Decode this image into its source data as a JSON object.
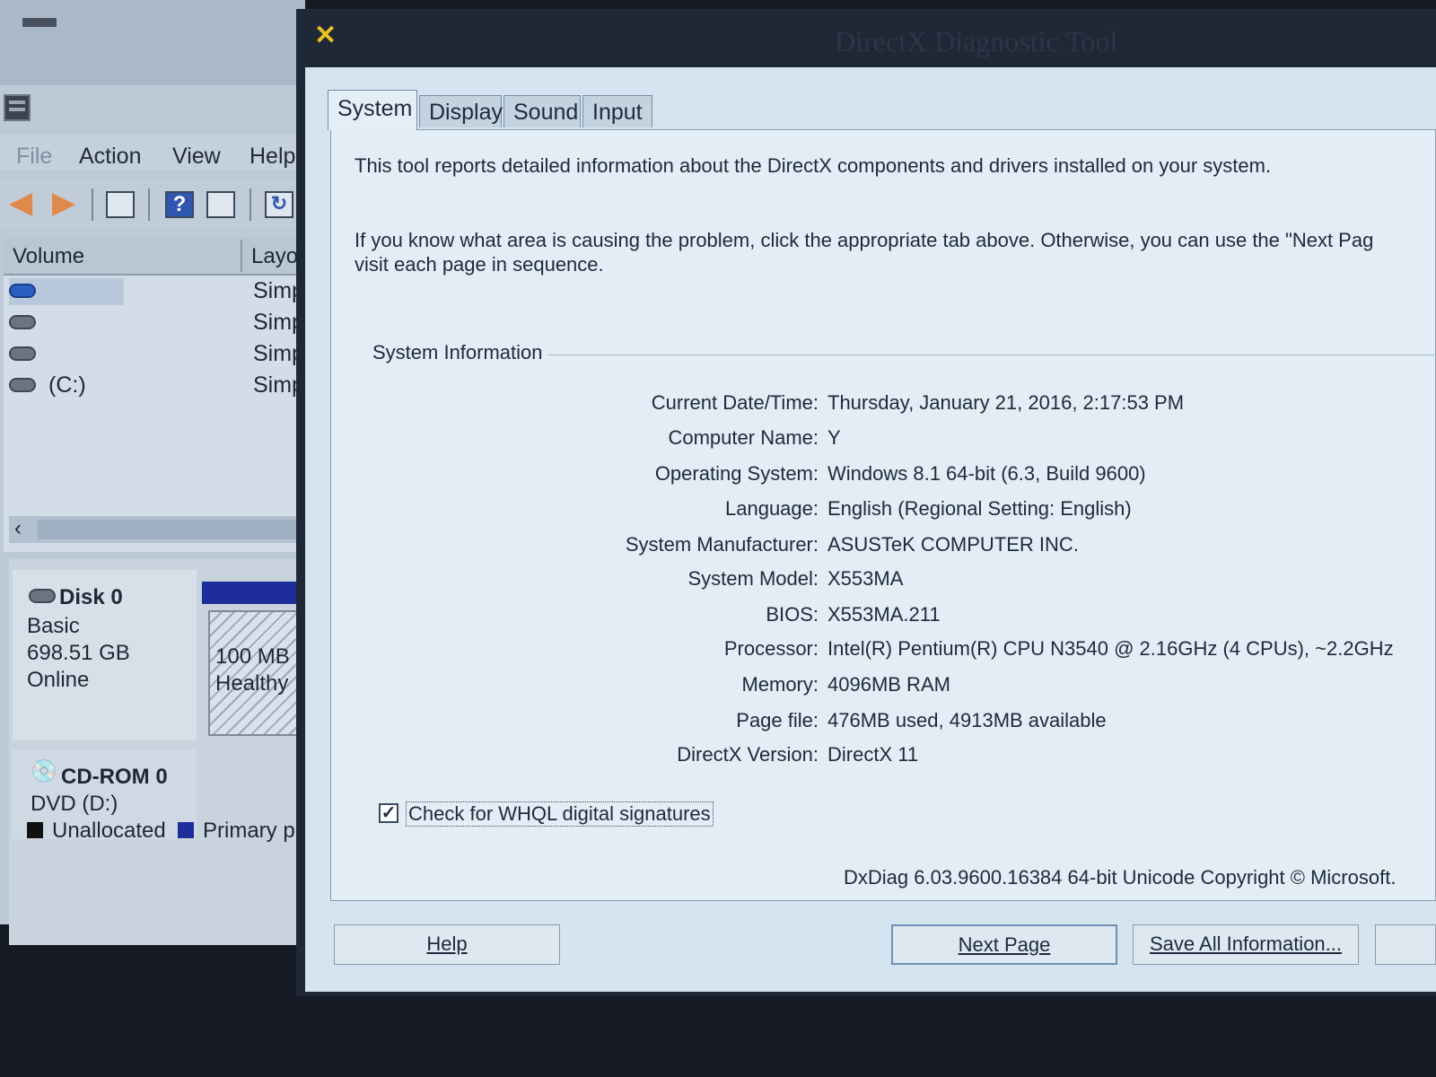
{
  "disk_management": {
    "menu": [
      "File",
      "Action",
      "View",
      "Help"
    ],
    "columns": {
      "volume": "Volume",
      "layout": "Layo"
    },
    "volumes": [
      {
        "name": "",
        "layout": "Simp",
        "highlighted": true
      },
      {
        "name": "",
        "layout": "Simp"
      },
      {
        "name": "",
        "layout": "Simp"
      },
      {
        "name": "(C:)",
        "layout": "Simp"
      }
    ],
    "disk0": {
      "name": "Disk 0",
      "type": "Basic",
      "size": "698.51 GB",
      "status": "Online",
      "partition_size": "100 MB",
      "partition_status": "Healthy"
    },
    "cdrom": {
      "name": "CD-ROM 0",
      "drive": "DVD (D:)"
    },
    "legend": [
      {
        "label": "Unallocated",
        "color": "#111111"
      },
      {
        "label": "Primary p",
        "color": "#1d2e9a"
      }
    ],
    "toolbar_icons": [
      "back-arrow-icon",
      "forward-arrow-icon",
      "console-icon",
      "help-icon",
      "properties-icon",
      "refresh-icon"
    ]
  },
  "dxdiag": {
    "title": "DirectX Diagnostic Tool",
    "tabs": [
      "System",
      "Display",
      "Sound",
      "Input"
    ],
    "active_tab": "System",
    "intro1": "This tool reports detailed information about the DirectX components and drivers installed on your system.",
    "intro2a": "If you know what area is causing the problem, click the appropriate tab above.  Otherwise, you can use the \"Next Pag",
    "intro2b": "visit each page in sequence.",
    "group_title": "System Information",
    "info": [
      {
        "label": "Current Date/Time:",
        "value": "Thursday, January 21, 2016, 2:17:53 PM"
      },
      {
        "label": "Computer Name:",
        "value": "Y"
      },
      {
        "label": "Operating System:",
        "value": "Windows 8.1 64-bit (6.3, Build 9600)"
      },
      {
        "label": "Language:",
        "value": "English (Regional Setting: English)"
      },
      {
        "label": "System Manufacturer:",
        "value": "ASUSTeK COMPUTER INC."
      },
      {
        "label": "System Model:",
        "value": "X553MA"
      },
      {
        "label": "BIOS:",
        "value": "X553MA.211"
      },
      {
        "label": "Processor:",
        "value": "Intel(R) Pentium(R) CPU  N3540  @ 2.16GHz (4 CPUs), ~2.2GHz"
      },
      {
        "label": "Memory:",
        "value": "4096MB RAM"
      },
      {
        "label": "Page file:",
        "value": "476MB used, 4913MB available"
      },
      {
        "label": "DirectX Version:",
        "value": "DirectX 11"
      }
    ],
    "whql_checkbox": {
      "label": "Check for WHQL digital signatures",
      "checked": true
    },
    "footer": "DxDiag 6.03.9600.16384 64-bit Unicode  Copyright © Microsoft.",
    "buttons": {
      "help": "Help",
      "next": "Next Page",
      "save": "Save All Information..."
    },
    "accent_color": "#e8c020"
  }
}
